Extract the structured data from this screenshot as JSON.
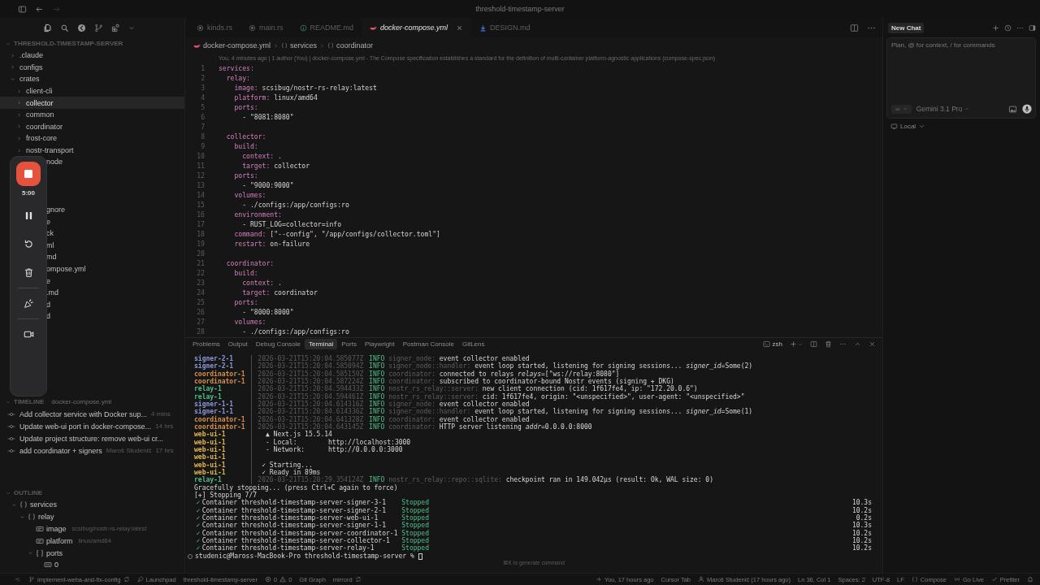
{
  "window": {
    "title": "threshold-timestamp-server"
  },
  "activity_bar": {
    "icons": [
      {
        "kind": "files",
        "selected": true
      },
      {
        "kind": "search",
        "selected": false
      },
      {
        "kind": "gitlens",
        "selected": false
      },
      {
        "kind": "branches",
        "selected": false
      },
      {
        "kind": "extensions",
        "selected": false
      },
      {
        "kind": "more",
        "selected": false
      }
    ]
  },
  "explorer": {
    "title": "THRESHOLD-TIMESTAMP-SERVER",
    "items": [
      {
        "label": ".claude",
        "expanded": false,
        "selected": false
      },
      {
        "label": "configs",
        "expanded": false,
        "selected": false
      },
      {
        "label": "crates",
        "expanded": true,
        "selected": false,
        "children": [
          {
            "label": "client-cli",
            "expanded": false,
            "selected": false
          },
          {
            "label": "collector",
            "expanded": false,
            "selected": true
          },
          {
            "label": "common",
            "expanded": false,
            "selected": false
          },
          {
            "label": "coordinator",
            "expanded": false,
            "selected": false
          },
          {
            "label": "frost-core",
            "expanded": false,
            "selected": false
          },
          {
            "label": "nostr-transport",
            "expanded": false,
            "selected": false
          }
        ]
      }
    ],
    "partly_hidden": [
      [
        "node"
      ],
      [
        "gnore",
        "e",
        "ck",
        "ml",
        "md",
        "ompose.yml",
        "e",
        ".md",
        "d",
        "d"
      ]
    ]
  },
  "recorder": {
    "time": "5:00"
  },
  "timeline": {
    "title": "TIMELINE",
    "subtitle": "docker-compose.yml",
    "items": [
      {
        "message": "Add collector service with Docker sup...",
        "time": "4 mins"
      },
      {
        "message": "Update web-ui port in docker-compose...",
        "time": "14 hrs"
      },
      {
        "message": "Update project structure: remove web-ui cr..."
      },
      {
        "message": "add coordinator + signers",
        "author": "Maroš Studenič",
        "time": "17 hrs"
      }
    ]
  },
  "outline": {
    "title": "OUTLINE",
    "items": [
      {
        "kind": "object",
        "label": "services",
        "expanded": true,
        "children": [
          {
            "kind": "object",
            "label": "relay",
            "expanded": true,
            "children": [
              {
                "kind": "string",
                "label": "image",
                "detail": "scsibug/nostr-rs-relay:latest"
              },
              {
                "kind": "string",
                "label": "platform",
                "detail": "linux/amd64"
              },
              {
                "kind": "array",
                "label": "ports",
                "expanded": true,
                "children": [
                  {
                    "kind": "number",
                    "label": "0"
                  }
                ]
              }
            ]
          }
        ]
      }
    ]
  },
  "editor_tabs": [
    {
      "label": "kinds.rs",
      "kind": "rust",
      "selected": false
    },
    {
      "label": "main.rs",
      "kind": "rust",
      "selected": false
    },
    {
      "label": "README.md",
      "kind": "info",
      "selected": false
    },
    {
      "label": "docker-compose.yml",
      "kind": "docker",
      "selected": true
    },
    {
      "label": "DESIGN.md",
      "kind": "download",
      "selected": false
    }
  ],
  "breadcrumbs": [
    {
      "label": "docker-compose.yml",
      "kind": "file"
    },
    {
      "label": "services",
      "kind": "object"
    },
    {
      "label": "coordinator",
      "kind": "object"
    }
  ],
  "blame": "You, 4 minutes ago | 1 author (You) | docker-compose.yml - The Compose specification establishes a standard for the definition of multi-container platform-agnostic applications (compose-spec.json)",
  "code": [
    {
      "n": "1",
      "key": "services:"
    },
    {
      "n": "2",
      "key": "  relay:"
    },
    {
      "n": "3",
      "key": "    image:",
      "value": " scsibug/nostr-rs-relay:latest"
    },
    {
      "n": "4",
      "key": "    platform:",
      "value": " linux/amd64"
    },
    {
      "n": "5",
      "key": "    ports:"
    },
    {
      "n": "6",
      "value": "      - \"8081:8080\""
    },
    {
      "n": "7"
    },
    {
      "n": "8",
      "key": "  collector:"
    },
    {
      "n": "9",
      "key": "    build:"
    },
    {
      "n": "10",
      "key": "      context:",
      "value": " ."
    },
    {
      "n": "11",
      "key": "      target:",
      "value": " collector"
    },
    {
      "n": "12",
      "key": "    ports:"
    },
    {
      "n": "13",
      "value": "      - \"9000:9000\""
    },
    {
      "n": "14",
      "key": "    volumes:"
    },
    {
      "n": "15",
      "value": "      - ./configs:/app/configs:ro"
    },
    {
      "n": "16",
      "key": "    environment:"
    },
    {
      "n": "17",
      "value": "      - RUST_LOG=collector=info"
    },
    {
      "n": "18",
      "key": "    command:",
      "value": " [\"--config\", \"/app/configs/collector.toml\"]"
    },
    {
      "n": "19",
      "key": "    restart:",
      "value": " on-failure"
    },
    {
      "n": "20"
    },
    {
      "n": "21",
      "key": "  coordinator:"
    },
    {
      "n": "22",
      "key": "    build:"
    },
    {
      "n": "23",
      "key": "      context:",
      "value": " ."
    },
    {
      "n": "24",
      "key": "      target:",
      "value": " coordinator"
    },
    {
      "n": "25",
      "key": "    ports:"
    },
    {
      "n": "26",
      "value": "      - \"8000:8000\""
    },
    {
      "n": "27",
      "key": "    volumes:"
    },
    {
      "n": "28",
      "value": "      - ./configs:/app/configs:ro"
    }
  ],
  "panel": {
    "tabs": [
      {
        "label": "Problems",
        "selected": false
      },
      {
        "label": "Output",
        "selected": false
      },
      {
        "label": "Debug Console",
        "selected": false
      },
      {
        "label": "Terminal",
        "selected": true
      },
      {
        "label": "Ports",
        "selected": false
      },
      {
        "label": "Playwright",
        "selected": false
      },
      {
        "label": "Postman Console",
        "selected": false
      },
      {
        "label": "GitLens",
        "selected": false
      }
    ],
    "shell": "zsh",
    "hint": "⌘K to generate command",
    "lines": [
      {
        "kind": "log",
        "service": "signer-2-1",
        "color": "#8c98dc",
        "timestamp": "2026-03-21T15:20:04.585077Z",
        "level": "INFO",
        "module": "signer_node:",
        "message": "event collector enabled"
      },
      {
        "kind": "log",
        "service": "signer-2-1",
        "color": "#8c98dc",
        "timestamp": "2026-03-21T15:20:04.585094Z",
        "level": "INFO",
        "module": "signer_node::handler:",
        "message": "event loop started, listening for signing sessions... *signer_id*=Some(2)"
      },
      {
        "kind": "log",
        "service": "coordinator-1",
        "color": "#d9904a",
        "timestamp": "2026-03-21T15:20:04.585159Z",
        "level": "INFO",
        "module": "coordinator:",
        "message": "connected to relays *relays*=[\"ws://relay:8080\"]"
      },
      {
        "kind": "log",
        "service": "coordinator-1",
        "color": "#d9904a",
        "timestamp": "2026-03-21T15:20:04.587224Z",
        "level": "INFO",
        "module": "coordinator:",
        "message": "subscribed to coordinator-bound Nostr events (signing + DKG)"
      },
      {
        "kind": "log",
        "service": "relay-1",
        "color": "#4fbf8a",
        "timestamp": "2026-03-21T15:20:04.594433Z",
        "level": "INFO",
        "module": "nostr_rs_relay::server:",
        "message": "new client connection (cid: 1f617fe4, ip: \"172.20.0.6\")"
      },
      {
        "kind": "log",
        "service": "relay-1",
        "color": "#4fbf8a",
        "timestamp": "2026-03-21T15:20:04.594461Z",
        "level": "INFO",
        "module": "nostr_rs_relay::server:",
        "message": "cid: 1f617fe4, origin: \"<unspecified>\", user-agent: \"<unspecified>\""
      },
      {
        "kind": "log",
        "service": "signer-1-1",
        "color": "#8c98dc",
        "timestamp": "2026-03-21T15:20:04.614316Z",
        "level": "INFO",
        "module": "signer_node:",
        "message": "event collector enabled"
      },
      {
        "kind": "log",
        "service": "signer-1-1",
        "color": "#8c98dc",
        "timestamp": "2026-03-21T15:20:04.614336Z",
        "level": "INFO",
        "module": "signer_node::handler:",
        "message": "event loop started, listening for signing sessions... *signer_id*=Some(1)"
      },
      {
        "kind": "log",
        "service": "coordinator-1",
        "color": "#d9904a",
        "timestamp": "2026-03-21T15:20:04.641328Z",
        "level": "INFO",
        "module": "coordinator:",
        "message": "event collector enabled"
      },
      {
        "kind": "log",
        "service": "coordinator-1",
        "color": "#d9904a",
        "timestamp": "2026-03-21T15:20:04.643145Z",
        "level": "INFO",
        "module": "coordinator:",
        "message": "HTTP server listening *addr*=0.0.0.0:8000"
      },
      {
        "kind": "app",
        "service": "web-ui-1",
        "color": "#e5b84a",
        "message": "  ▲ Next.js 15.5.14"
      },
      {
        "kind": "app",
        "service": "web-ui-1",
        "color": "#e5b84a",
        "message": "  - Local:        http://localhost:3000"
      },
      {
        "kind": "app",
        "service": "web-ui-1",
        "color": "#e5b84a",
        "message": "  - Network:      http://0.0.0.0:3000"
      },
      {
        "kind": "app",
        "service": "web-ui-1",
        "color": "#e5b84a"
      },
      {
        "kind": "app",
        "service": "web-ui-1",
        "color": "#e5b84a",
        "message": " ✓ Starting..."
      },
      {
        "kind": "app",
        "service": "web-ui-1",
        "color": "#e5b84a",
        "message": " ✓ Ready in 89ms"
      },
      {
        "kind": "log",
        "service": "relay-1",
        "color": "#4fbf8a",
        "timestamp": "2026-03-21T15:20:29.354124Z",
        "level": "INFO",
        "module": "nostr_rs_relay::repo::sqlite:",
        "message": "checkpoint ran in 149.042µs (result: Ok, WAL size: 0)"
      },
      {
        "kind": "plain",
        "message": "Gracefully stopping... (press Ctrl+C again to force)"
      },
      {
        "kind": "plain",
        "message": "[+] Stopping 7/7"
      },
      {
        "kind": "container",
        "check": "✓",
        "message": "Container threshold-timestamp-server-signer-3-1",
        "status": "Stopped",
        "duration": "10.3s"
      },
      {
        "kind": "container",
        "check": "✓",
        "message": "Container threshold-timestamp-server-signer-2-1",
        "status": "Stopped",
        "duration": "10.2s"
      },
      {
        "kind": "container",
        "check": "✓",
        "message": "Container threshold-timestamp-server-web-ui-1",
        "status": "Stopped",
        "duration": "0.2s"
      },
      {
        "kind": "container",
        "check": "✓",
        "message": "Container threshold-timestamp-server-signer-1-1",
        "status": "Stopped",
        "duration": "10.3s"
      },
      {
        "kind": "container",
        "check": "✓",
        "message": "Container threshold-timestamp-server-coordinator-1",
        "status": "Stopped",
        "duration": "10.2s"
      },
      {
        "kind": "container",
        "check": "✓",
        "message": "Container threshold-timestamp-server-collector-1",
        "status": "Stopped",
        "duration": "10.2s"
      },
      {
        "kind": "container",
        "check": "✓",
        "message": "Container threshold-timestamp-server-relay-1",
        "status": "Stopped",
        "duration": "10.2s"
      },
      {
        "kind": "prompt",
        "message": "studenic@Maross-MacBook-Pro threshold-timestamp-server %"
      }
    ]
  },
  "chat": {
    "tab": "New Chat",
    "placeholder": "Plan, @ for context, / for commands",
    "mode": "∞",
    "model": "Gemini 3.1 Pro",
    "environment": "Local"
  },
  "status_bar": {
    "branch": "implement-weba-and-fix-config",
    "launchpad": "Launchpad",
    "project": "threshold-timestamp-server",
    "errors": "0",
    "warnings": "0",
    "git_graph": "Git Graph",
    "mirrord": "mirrord",
    "blame": "You, 17 hours ago",
    "cursor_tab": "Cursor Tab",
    "author": "Maroš Studenič (17 hours ago)",
    "position": "Ln 36, Col 1",
    "spaces": "Spaces: 2",
    "encoding": "UTF-8",
    "eol": "LF",
    "language": "Compose",
    "go_live": "Go Live",
    "formatter": "Prettier"
  }
}
